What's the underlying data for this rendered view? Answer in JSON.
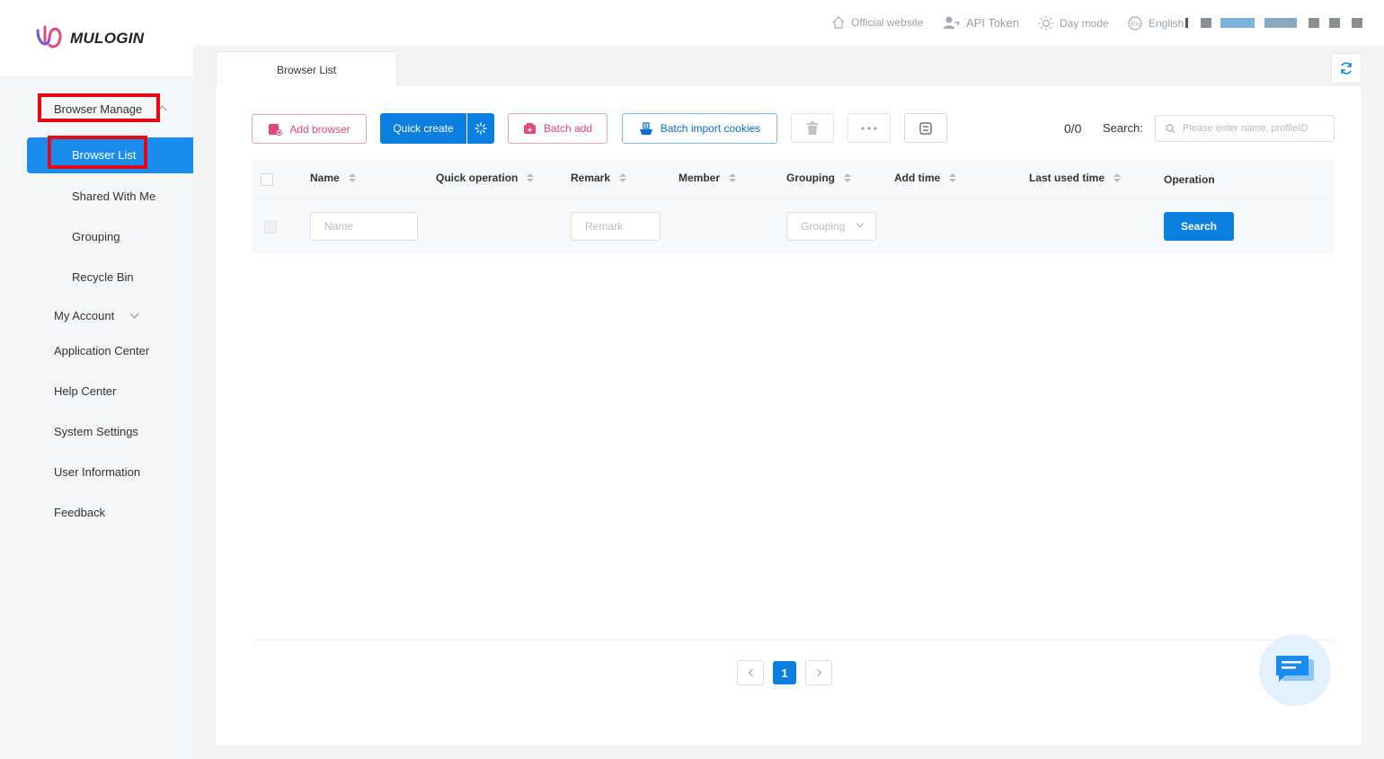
{
  "app": {
    "logo_text": "MULOGIN"
  },
  "topbar": {
    "official_website": "Official website",
    "api_token": "API Token",
    "day_mode": "Day mode",
    "language": "English"
  },
  "sidebar": {
    "browser_manage": "Browser Manage",
    "items": [
      {
        "label": "Browser List",
        "active": true
      },
      {
        "label": "Shared With Me"
      },
      {
        "label": "Grouping"
      },
      {
        "label": "Recycle Bin"
      }
    ],
    "my_account": "My Account",
    "application_center": "Application Center",
    "help_center": "Help Center",
    "system_settings": "System Settings",
    "user_information": "User Information",
    "feedback": "Feedback"
  },
  "tabs": {
    "active": "Browser List"
  },
  "toolbar": {
    "add_browser": "Add browser",
    "quick_create": "Quick create",
    "batch_add": "Batch add",
    "batch_import_cookies": "Batch import cookies",
    "count": "0/0",
    "search_label": "Search:",
    "search_placeholder": "Please enter name, profileID"
  },
  "table": {
    "columns": [
      "Name",
      "Quick operation",
      "Remark",
      "Member",
      "Grouping",
      "Add time",
      "Last used time",
      "Operation"
    ],
    "filters": {
      "name_placeholder": "Name",
      "remark_placeholder": "Remark",
      "grouping_placeholder": "Grouping",
      "search_button": "Search"
    }
  },
  "pagination": {
    "current": "1"
  },
  "colors": {
    "primary": "#0b7fe0",
    "pink": "#e0487e",
    "highlight": "#e50914"
  }
}
